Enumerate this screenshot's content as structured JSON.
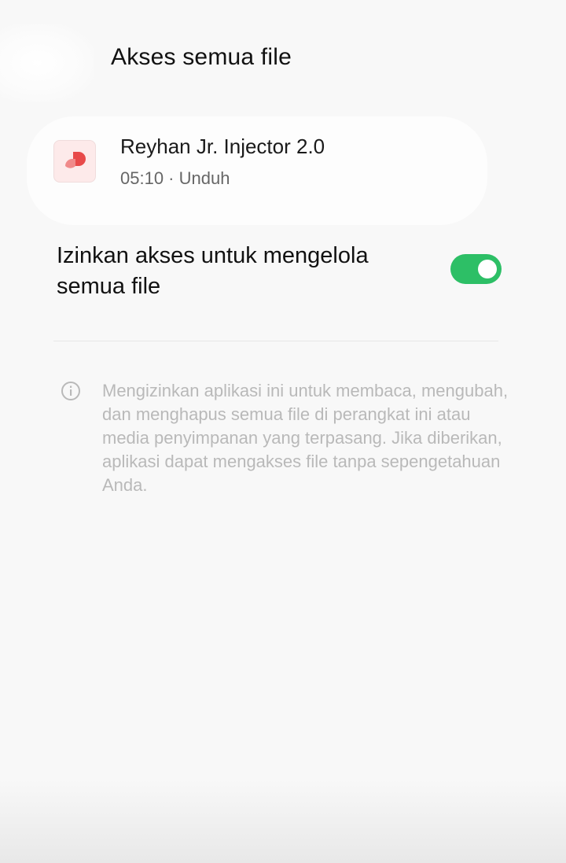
{
  "header": {
    "title": "Akses semua file"
  },
  "app": {
    "name": "Reyhan Jr. Injector 2.0",
    "meta": "05:10 · Unduh",
    "icon": "app-logo-icon",
    "icon_color": "#e84a4a"
  },
  "permission": {
    "label": "Izinkan akses untuk mengelola semua file",
    "enabled": true,
    "switch_color": "#2dbf66"
  },
  "info": {
    "icon": "info-icon",
    "text": "Mengizinkan aplikasi ini untuk membaca, mengubah, dan menghapus semua file di perangkat ini atau media penyimpanan yang terpasang. Jika diberikan, aplikasi dapat mengakses file tanpa sepengetahuan Anda."
  }
}
